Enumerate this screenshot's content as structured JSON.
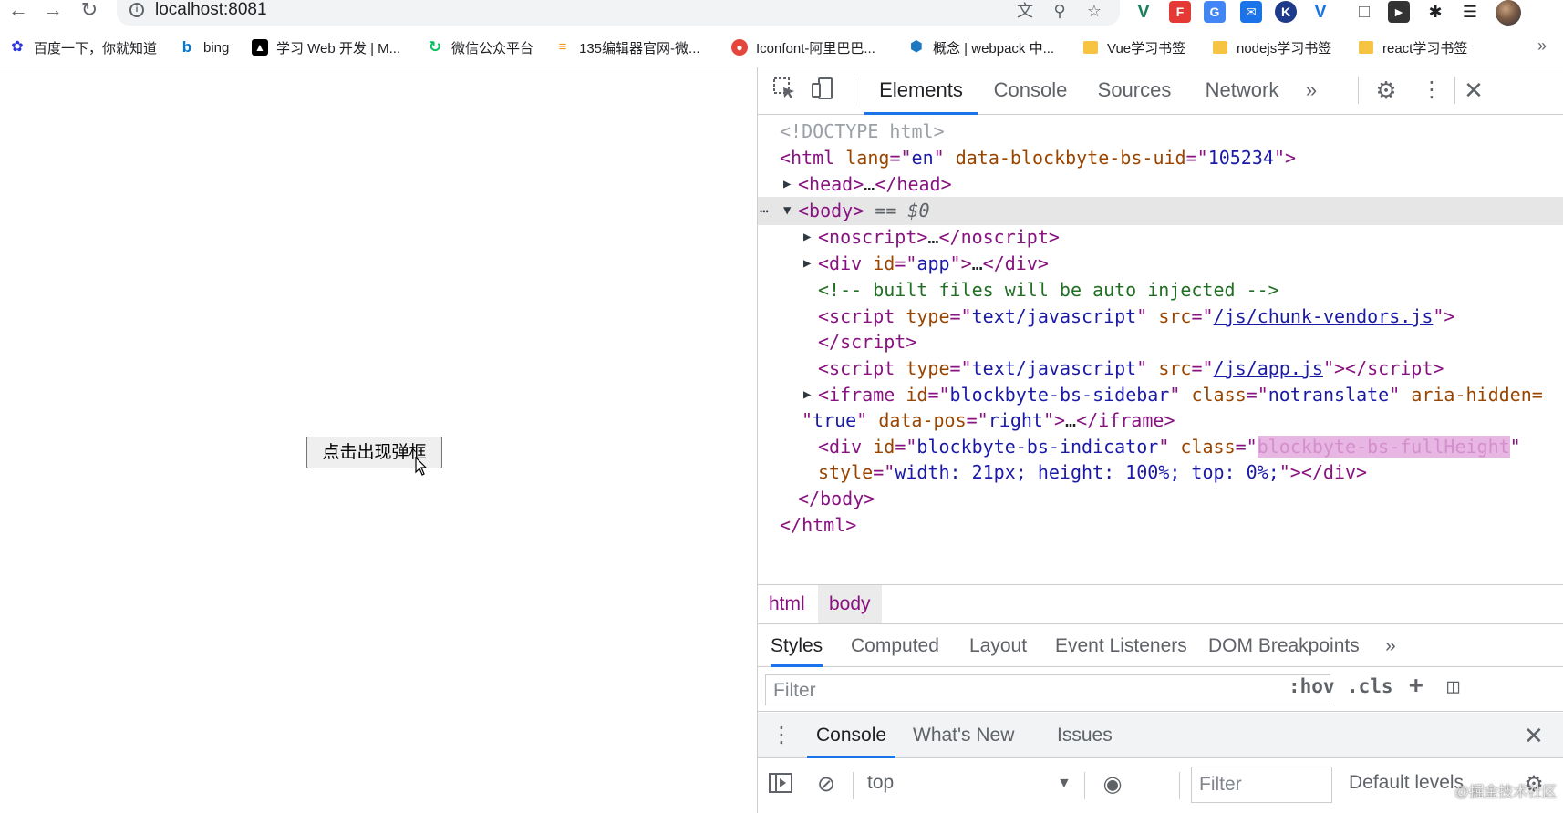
{
  "browser": {
    "url": "localhost:8081",
    "bookmarks": [
      {
        "label": "百度一下，你就知道"
      },
      {
        "label": "bing"
      },
      {
        "label": "学习 Web 开发 | M..."
      },
      {
        "label": "微信公众平台"
      },
      {
        "label": "135编辑器官网-微..."
      },
      {
        "label": "Iconfont-阿里巴巴..."
      },
      {
        "label": "概念 | webpack 中..."
      },
      {
        "label": "Vue学习书签"
      },
      {
        "label": "nodejs学习书签"
      },
      {
        "label": "react学习书签"
      }
    ],
    "more": "»"
  },
  "page": {
    "button_label": "点击出现弹框"
  },
  "devtools": {
    "tabs": [
      "Elements",
      "Console",
      "Sources",
      "Network"
    ],
    "tabs_more": "»",
    "dom": {
      "doctype": "<!DOCTYPE html>",
      "html_open_tag": "html",
      "html_lang_attr": "lang",
      "html_lang_val": "en",
      "html_uid_attr": "data-blockbyte-bs-uid",
      "html_uid_val": "105234",
      "head": "head",
      "ellipsis": "…",
      "body": "body",
      "selected_marker": "== $0",
      "noscript": "noscript",
      "div": "div",
      "id_attr": "id",
      "app_id": "app",
      "comment": "<!-- built files will be auto injected -->",
      "script": "script",
      "type_attr": "type",
      "type_val": "text/javascript",
      "src_attr": "src",
      "src1": "/js/chunk-vendors.js",
      "src2": "/js/app.js",
      "iframe": "iframe",
      "iframe_id": "blockbyte-bs-sidebar",
      "class_attr": "class",
      "iframe_class": "notranslate",
      "aria_attr": "aria-hidden=",
      "aria_val": "true",
      "pos_attr": "data-pos",
      "pos_val": "right",
      "indicator_id": "blockbyte-bs-indicator",
      "indicator_class": "blockbyte-bs-fullHeight",
      "style_attr": "style",
      "style_val": "width: 21px; height: 100%; top: 0%;",
      "html_close": "html"
    },
    "breadcrumbs": [
      "html",
      "body"
    ],
    "styles_tabs": [
      "Styles",
      "Computed",
      "Layout",
      "Event Listeners",
      "DOM Breakpoints"
    ],
    "styles_more": "»",
    "filter_placeholder": "Filter",
    "hov": ":hov",
    "cls": ".cls",
    "plus": "+",
    "drawer_tabs": [
      "Console",
      "What's New",
      "Issues"
    ],
    "console_context": "top",
    "console_filter_placeholder": "Filter",
    "log_levels": "Default levels",
    "watermark": "@掘金技术社区"
  }
}
